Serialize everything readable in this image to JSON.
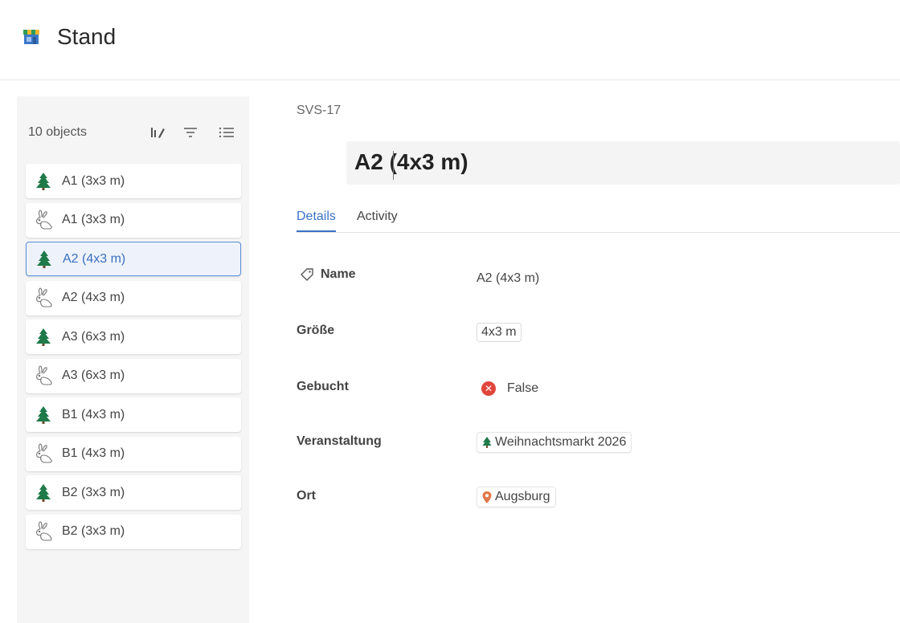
{
  "app": {
    "title": "Stand",
    "icon": "stand-booth-icon"
  },
  "sidebar": {
    "count_label": "10 objects",
    "tools": [
      "sort-edit-icon",
      "filter-icon",
      "list-view-icon"
    ],
    "items": [
      {
        "label": "A1 (3x3 m)",
        "icon": "tree-icon",
        "selected": false
      },
      {
        "label": "A1 (3x3 m)",
        "icon": "bunny-icon",
        "selected": false
      },
      {
        "label": "A2 (4x3 m)",
        "icon": "tree-icon",
        "selected": true
      },
      {
        "label": "A2 (4x3 m)",
        "icon": "bunny-icon",
        "selected": false
      },
      {
        "label": "A3 (6x3 m)",
        "icon": "tree-icon",
        "selected": false
      },
      {
        "label": "A3 (6x3 m)",
        "icon": "bunny-icon",
        "selected": false
      },
      {
        "label": "B1 (4x3 m)",
        "icon": "tree-icon",
        "selected": false
      },
      {
        "label": "B1 (4x3 m)",
        "icon": "bunny-icon",
        "selected": false
      },
      {
        "label": "B2 (3x3 m)",
        "icon": "tree-icon",
        "selected": false
      },
      {
        "label": "B2 (3x3 m)",
        "icon": "bunny-icon",
        "selected": false
      }
    ]
  },
  "record": {
    "id": "SVS-17",
    "title": "A2 (4x3 m)",
    "tabs": [
      {
        "label": "Details",
        "active": true
      },
      {
        "label": "Activity",
        "active": false
      }
    ],
    "fields": {
      "name": {
        "label": "Name",
        "value": "A2 (4x3 m)"
      },
      "groesse": {
        "label": "Größe",
        "value": "4x3 m"
      },
      "gebucht": {
        "label": "Gebucht",
        "value": "False"
      },
      "veranstaltung": {
        "label": "Veranstaltung",
        "value": "Weihnachtsmarkt 2026"
      },
      "ort": {
        "label": "Ort",
        "value": "Augsburg"
      }
    }
  },
  "colors": {
    "accent": "#3a72c6",
    "selected_bg": "#eef3fb",
    "tree_green": "#1f7a4a",
    "false_red": "#e0463c",
    "pin_orange": "#e0784a"
  }
}
